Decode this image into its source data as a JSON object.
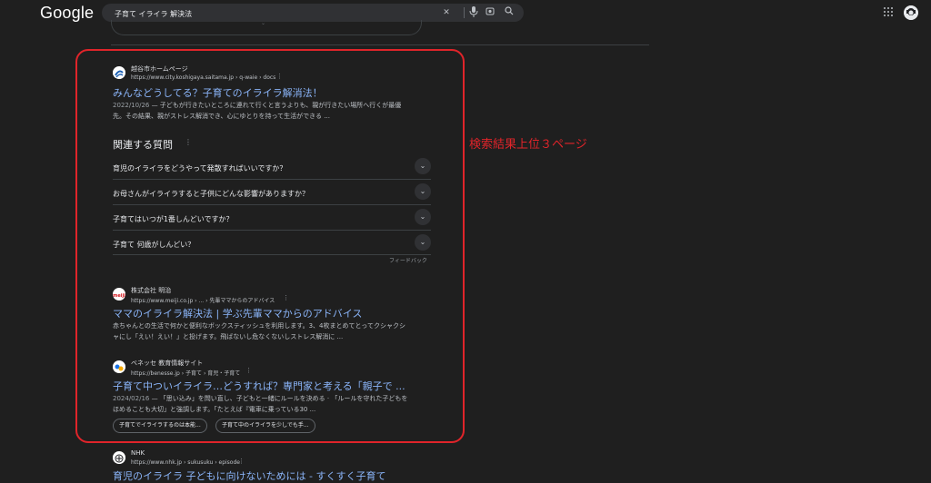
{
  "header": {
    "logo": "Google",
    "search_value": "子育て イライラ 解決法"
  },
  "annotation": "検索結果上位３ページ",
  "results": [
    {
      "site_name": "越谷市ホームページ",
      "url": "https://www.city.koshigaya.saitama.jp › q-waie › docs",
      "title": "みんなどうしてる？子育てのイライラ解消法！",
      "date": "2022/10/26",
      "snippet_line1": " — 子どもが行きたいところに連れて行くと言うよりも、親が行きたい場所へ行くが最優",
      "snippet_line2": "先。その結果、親がストレス解消でき、心にゆとりを持って生活ができる ..."
    },
    {
      "site_name": "株式会社 明治",
      "url": "https://www.meiji.co.jp › ... › 先輩ママからのアドバイス",
      "title": "ママのイライラ解決法 | 学ぶ先輩ママからのアドバイス",
      "snippet_line1": "赤ちゃんとの生活で何かと便利なボックスティッシュを利用します。3、4枚まとめてとってクシャクシ",
      "snippet_line2": "ャにし「えい！えい！」と投げます。飛ばないし危なくないしストレス解消に ..."
    },
    {
      "site_name": "ベネッセ 教育情報サイト",
      "url": "https://benesse.jp › 子育て › 育児・子育て",
      "title": "子育て中ついイライラ…どうすれば？専門家と考える「親子で ...",
      "date": "2024/02/16",
      "snippet_line1": " — 「思い込み」を問い直し、子どもと一緒にルールを決める · 「ルールを守れた子どもを",
      "snippet_line2": "ほめることも大切」と強調します。「たとえば『電車に乗っている30 ..."
    },
    {
      "site_name": "NHK",
      "url": "https://www.nhk.jp › sukusuku › episode",
      "title": "育児のイライラ 子どもに向けないためには - すくすく子育て"
    }
  ],
  "paa": {
    "heading": "関連する質問",
    "questions": [
      "育児のイライラをどうやって発散すればいいですか？",
      "お母さんがイライラすると子供にどんな影響がありますか？",
      "子育てはいつが1番しんどいですか？",
      "子育て 何歳がしんどい？"
    ],
    "feedback": "フィードバック"
  },
  "chips": [
    "子育てでイライラするのは本能...",
    "子育て中のイライラを少しでも手..."
  ],
  "icons": {
    "search_clear": "close-icon",
    "voice": "mic-icon",
    "lens": "camera-icon",
    "search": "search-icon",
    "apps": "apps-grid-icon",
    "profile": "avatar"
  },
  "colors": {
    "background": "#1f1f1f",
    "link": "#8ab4f8",
    "annotation": "#e0242a"
  }
}
